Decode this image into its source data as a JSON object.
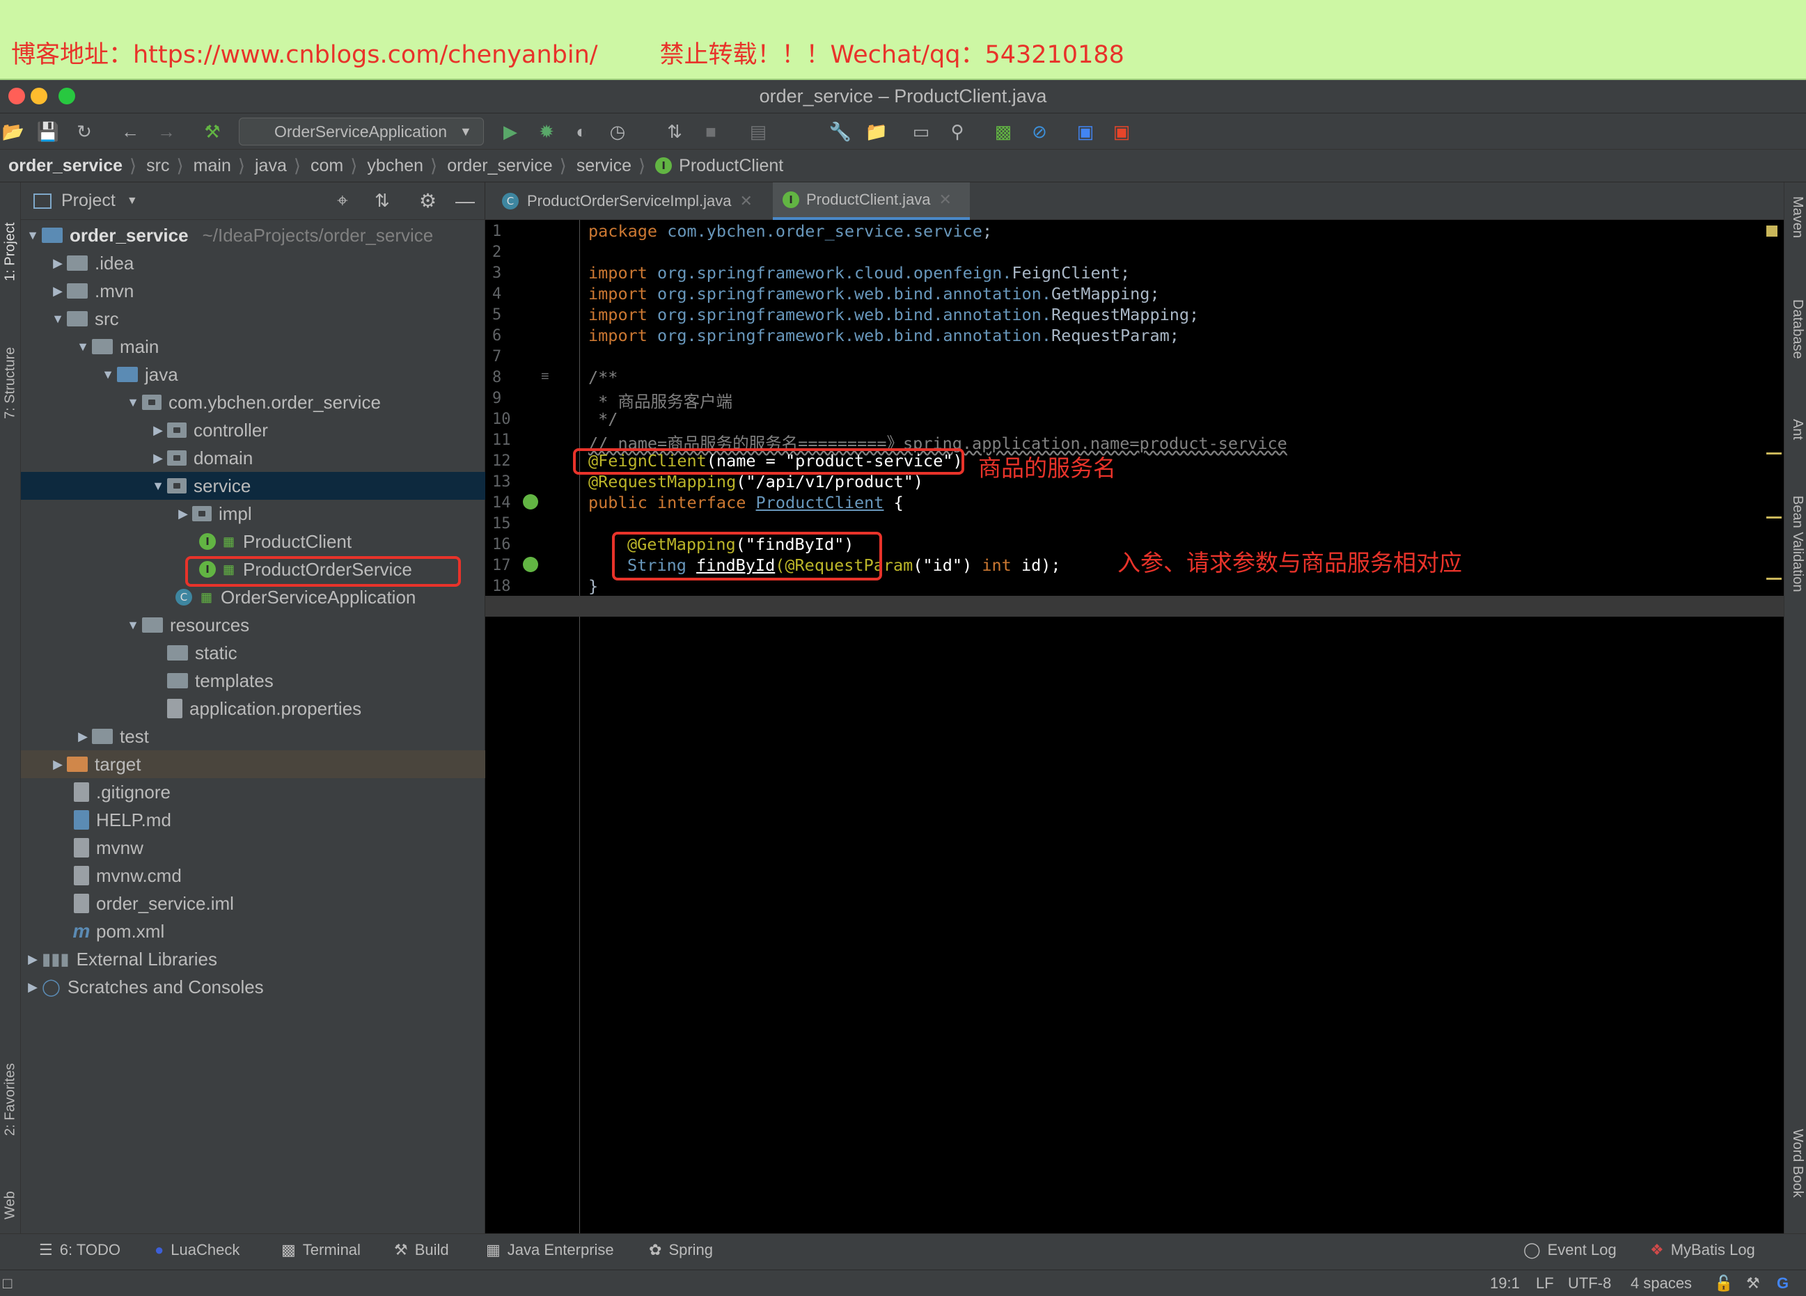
{
  "banner": {
    "text": "博客地址：https://www.cnblogs.com/chenyanbin/        禁止转载！！！Wechat/qq：543210188"
  },
  "window": {
    "title": "order_service – ProductClient.java"
  },
  "toolbar": {
    "run_config": "OrderServiceApplication"
  },
  "breadcrumbs": [
    "order_service",
    "src",
    "main",
    "java",
    "com",
    "ybchen",
    "order_service",
    "service",
    "ProductClient"
  ],
  "project": {
    "header": "Project",
    "root": {
      "name": "order_service",
      "path": "~/IdeaProjects/order_service"
    },
    "items": [
      ".idea",
      ".mvn",
      "src",
      "main",
      "java",
      "com.ybchen.order_service",
      "controller",
      "domain",
      "service",
      "impl",
      "ProductClient",
      "ProductOrderService",
      "OrderServiceApplication",
      "resources",
      "static",
      "templates",
      "application.properties",
      "test",
      "target",
      ".gitignore",
      "HELP.md",
      "mvnw",
      "mvnw.cmd",
      "order_service.iml",
      "pom.xml",
      "External Libraries",
      "Scratches and Consoles"
    ]
  },
  "left_strip": {
    "project": "1: Project",
    "structure": "7: Structure",
    "favorites": "2: Favorites",
    "web": "Web"
  },
  "right_strip": {
    "maven": "Maven",
    "database": "Database",
    "ant": "Ant",
    "bean": "Bean Validation",
    "word": "Word Book"
  },
  "tabs": [
    {
      "label": "ProductOrderServiceImpl.java",
      "icon": "C"
    },
    {
      "label": "ProductClient.java",
      "icon": "I"
    }
  ],
  "editor": {
    "line_numbers": [
      "1",
      "2",
      "3",
      "4",
      "5",
      "6",
      "7",
      "8",
      "9",
      "10",
      "11",
      "12",
      "13",
      "14",
      "15",
      "16",
      "17",
      "18"
    ],
    "lines": {
      "l1_kw": "package",
      "l1_pk": " com.ybchen.order_service.service",
      "l1_end": ";",
      "import_kw": "import",
      "l3_pk": " org.springframework.cloud.openfeign.",
      "l3_cls": "FeignClient",
      "l4_pk": " org.springframework.web.bind.annotation.",
      "l4_cls": "GetMapping",
      "l5_pk": " org.springframework.web.bind.annotation.",
      "l5_cls": "RequestMapping",
      "l6_pk": " org.springframework.web.bind.annotation.",
      "l6_cls": "RequestParam",
      "semi": ";",
      "l8": "/**",
      "l9": " * 商品服务客户端",
      "l10": " */",
      "l11": "// name=商品服务的服务名=========》spring.application.name=product-service",
      "l12_ann": "@FeignClient",
      "l12_open": "(name = ",
      "l12_str": "\"product-service\"",
      "l12_close": ")",
      "l13_ann": "@RequestMapping",
      "l13_open": "(",
      "l13_str": "\"/api/v1/product\"",
      "l13_close": ")",
      "l14_kw1": "public interface",
      "l14_name": "ProductClient",
      "l14_brace": " {",
      "l16_ann": "@GetMapping",
      "l16_open": "(",
      "l16_str": "\"findById\"",
      "l16_close": ")",
      "l17_type": "String",
      "l17_method": "findById",
      "l17_ann": "(@RequestParam",
      "l17_open": "(",
      "l17_str": "\"id\"",
      "l17_mid": ") ",
      "l17_kw": "int",
      "l17_end": " id);",
      "l18": "}"
    }
  },
  "callouts": {
    "service_name": "商品的服务名",
    "params": "入参、请求参数与商品服务相对应"
  },
  "bottom_tabs": {
    "todo": "6: TODO",
    "luacheck": "LuaCheck",
    "terminal": "Terminal",
    "build": "Build",
    "java_enterprise": "Java Enterprise",
    "spring": "Spring",
    "event_log": "Event Log",
    "mybatis_log": "MyBatis Log"
  },
  "status": {
    "position": "19:1",
    "line_sep": "LF",
    "encoding": "UTF-8",
    "indent": "4 spaces"
  },
  "colors": {
    "keyword": "#cc7832",
    "package": "#6897bb",
    "annotation": "#bbb529",
    "string": "#6a8759",
    "callout": "#e8332a",
    "selection": "#0d293e"
  }
}
